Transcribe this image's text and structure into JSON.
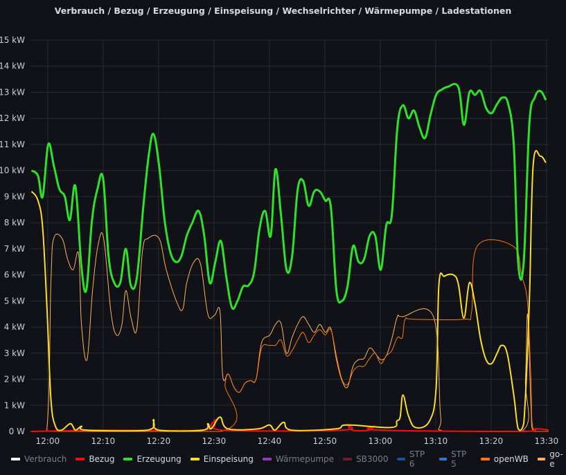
{
  "chart_data": {
    "type": "line",
    "title": "Verbrauch / Bezug / Erzeugung / Einspeisung / Wechselrichter / Wärmepumpe / Ladestationen",
    "x_unit": "minutes after 12:00",
    "xlim": [
      -3.1,
      90.4
    ],
    "ylim": [
      0,
      15
    ],
    "ylabel": "",
    "xlabel": "",
    "y_ticks": [
      0,
      1,
      2,
      3,
      4,
      5,
      6,
      7,
      8,
      9,
      10,
      11,
      12,
      13,
      14,
      15
    ],
    "y_tick_labels": [
      "0 W",
      "1 kW",
      "2 kW",
      "3 kW",
      "4 kW",
      "5 kW",
      "6 kW",
      "7 kW",
      "8 kW",
      "9 kW",
      "10 kW",
      "11 kW",
      "12 kW",
      "13 kW",
      "14 kW",
      "15 kW"
    ],
    "x_ticks": [
      0,
      10,
      20,
      30,
      40,
      50,
      60,
      70,
      80,
      90
    ],
    "x_tick_labels": [
      "12:00",
      "12:10",
      "12:20",
      "12:30",
      "12:40",
      "12:50",
      "13:00",
      "13:10",
      "13:20",
      "13:30"
    ],
    "grid": true,
    "legend_position": "bottom-left",
    "series": [
      {
        "name": "Verbrauch",
        "color": "#ffffff",
        "hidden": true,
        "points": []
      },
      {
        "name": "Bezug",
        "color": "#f2110f",
        "hidden": false,
        "points": [
          [
            -3,
            0
          ],
          [
            10,
            0.05
          ],
          [
            28,
            0.05
          ],
          [
            30.2,
            0.45
          ],
          [
            31.5,
            0.05
          ],
          [
            53,
            0.05
          ],
          [
            54,
            0.25
          ],
          [
            55,
            0.05
          ],
          [
            58,
            0.05
          ],
          [
            59,
            0.2
          ],
          [
            60,
            0.05
          ],
          [
            85,
            0
          ],
          [
            88,
            0.1
          ],
          [
            90.4,
            0.05
          ]
        ]
      },
      {
        "name": "Erzeugung",
        "color": "#2fe12a",
        "hidden": false,
        "points": [
          [
            -2.9,
            10
          ],
          [
            -1.75,
            9.8
          ],
          [
            -0.9,
            9.0
          ],
          [
            0.1,
            11.0
          ],
          [
            1.1,
            10.2
          ],
          [
            2.1,
            9.3
          ],
          [
            3.1,
            9.0
          ],
          [
            4,
            8.1
          ],
          [
            5,
            9.4
          ],
          [
            6.1,
            6.3
          ],
          [
            7,
            5.45
          ],
          [
            8,
            8.1
          ],
          [
            9,
            9.3
          ],
          [
            10,
            9.7
          ],
          [
            11,
            6.7
          ],
          [
            12,
            5.7
          ],
          [
            13.1,
            5.7
          ],
          [
            14.1,
            7.0
          ],
          [
            15,
            5.6
          ],
          [
            16.1,
            5.9
          ],
          [
            17.25,
            8.6
          ],
          [
            18.25,
            10.6
          ],
          [
            19.1,
            11.4
          ],
          [
            20.1,
            10.2
          ],
          [
            21.1,
            8.1
          ],
          [
            22.1,
            6.9
          ],
          [
            23.1,
            6.5
          ],
          [
            24.1,
            6.7
          ],
          [
            25.1,
            7.5
          ],
          [
            26.1,
            8.0
          ],
          [
            27.25,
            8.45
          ],
          [
            28.25,
            7.5
          ],
          [
            29.25,
            5.7
          ],
          [
            30.25,
            6.5
          ],
          [
            31.25,
            7.3
          ],
          [
            32.25,
            5.9
          ],
          [
            33.25,
            4.75
          ],
          [
            34.25,
            5.0
          ],
          [
            35.25,
            5.55
          ],
          [
            36.25,
            5.6
          ],
          [
            37.25,
            6.1
          ],
          [
            38.25,
            7.8
          ],
          [
            39.25,
            8.45
          ],
          [
            40.25,
            7.5
          ],
          [
            41.1,
            10.05
          ],
          [
            42.1,
            8.3
          ],
          [
            43.1,
            6.2
          ],
          [
            44.1,
            6.7
          ],
          [
            45.1,
            9.25
          ],
          [
            46.1,
            9.6
          ],
          [
            47.1,
            8.65
          ],
          [
            48.1,
            9.2
          ],
          [
            49.1,
            9.2
          ],
          [
            50.1,
            8.85
          ],
          [
            51.1,
            8.6
          ],
          [
            52.1,
            5.4
          ],
          [
            53.1,
            5.0
          ],
          [
            54.1,
            5.55
          ],
          [
            55.1,
            7.1
          ],
          [
            56.1,
            6.5
          ],
          [
            57.1,
            6.6
          ],
          [
            58.1,
            7.5
          ],
          [
            59.1,
            7.5
          ],
          [
            60.1,
            6.2
          ],
          [
            61.1,
            7.9
          ],
          [
            62.1,
            8.3
          ],
          [
            63.1,
            11.65
          ],
          [
            64.1,
            12.5
          ],
          [
            65.1,
            12.0
          ],
          [
            66.1,
            12.3
          ],
          [
            67.1,
            11.65
          ],
          [
            68.1,
            11.25
          ],
          [
            69.1,
            12.15
          ],
          [
            70.1,
            12.9
          ],
          [
            71.1,
            13.1
          ],
          [
            72.1,
            13.2
          ],
          [
            74.1,
            13.2
          ],
          [
            75.1,
            11.75
          ],
          [
            76.1,
            13.0
          ],
          [
            77.1,
            12.9
          ],
          [
            78.1,
            13.05
          ],
          [
            79.1,
            12.4
          ],
          [
            80.1,
            12.2
          ],
          [
            81.1,
            12.55
          ],
          [
            82.1,
            12.8
          ],
          [
            83.1,
            12.55
          ],
          [
            84.1,
            11.0
          ],
          [
            84.9,
            6.45
          ],
          [
            85.9,
            6.5
          ],
          [
            86.9,
            11.75
          ],
          [
            87.9,
            12.8
          ],
          [
            88.9,
            13.05
          ],
          [
            89.9,
            12.7
          ]
        ]
      },
      {
        "name": "Einspeisung",
        "color": "#fade2a",
        "hidden": false,
        "points": [
          [
            -2.9,
            9.2
          ],
          [
            -1.75,
            8.85
          ],
          [
            -0.9,
            7.8
          ],
          [
            -0.1,
            4.6
          ],
          [
            0.6,
            1.2
          ],
          [
            1.4,
            0.2
          ],
          [
            2.5,
            0.05
          ],
          [
            4.1,
            0.3
          ],
          [
            5,
            0.05
          ],
          [
            6.1,
            0.2
          ],
          [
            7,
            0.05
          ],
          [
            18,
            0.05
          ],
          [
            19.1,
            0.45
          ],
          [
            20,
            0.05
          ],
          [
            28,
            0.05
          ],
          [
            28.9,
            0.3
          ],
          [
            29.5,
            0.1
          ],
          [
            31.1,
            0.55
          ],
          [
            32.5,
            0.1
          ],
          [
            38,
            0.1
          ],
          [
            40,
            0.25
          ],
          [
            41,
            0.05
          ],
          [
            42.6,
            0.35
          ],
          [
            44,
            0.05
          ],
          [
            52,
            0.1
          ],
          [
            54,
            0.25
          ],
          [
            62,
            0.15
          ],
          [
            63,
            0.4
          ],
          [
            63.6,
            0.55
          ],
          [
            64.1,
            1.4
          ],
          [
            65.1,
            0.6
          ],
          [
            66.4,
            0.15
          ],
          [
            68.9,
            0.4
          ],
          [
            70.1,
            1.7
          ],
          [
            70.6,
            5.65
          ],
          [
            71.6,
            5.95
          ],
          [
            73.2,
            6.0
          ],
          [
            74.1,
            5.65
          ],
          [
            75.1,
            4.35
          ],
          [
            76.1,
            5.7
          ],
          [
            77.1,
            4.9
          ],
          [
            78.1,
            3.55
          ],
          [
            79.1,
            2.75
          ],
          [
            80.1,
            2.6
          ],
          [
            81.1,
            3.0
          ],
          [
            81.9,
            3.3
          ],
          [
            82.9,
            3.0
          ],
          [
            84.1,
            1.4
          ],
          [
            84.9,
            0.1
          ],
          [
            85.9,
            0.3
          ],
          [
            86.9,
            4.9
          ],
          [
            87.6,
            10.2
          ],
          [
            88.9,
            10.55
          ],
          [
            89.9,
            10.3
          ]
        ]
      },
      {
        "name": "Wärmepumpe",
        "color": "#8f3bb8",
        "hidden": true,
        "points": []
      },
      {
        "name": "SB3000",
        "color": "#6e1f2b",
        "hidden": true,
        "points": []
      },
      {
        "name": "STP 6",
        "color": "#1f4ba0",
        "hidden": true,
        "points": []
      },
      {
        "name": "STP 5",
        "color": "#3274d9",
        "hidden": true,
        "points": []
      },
      {
        "name": "openWB",
        "color": "#ff780a",
        "hidden": false,
        "points": [
          [
            -3,
            0
          ],
          [
            31.2,
            0
          ],
          [
            32,
            1.8
          ],
          [
            32.6,
            2.2
          ],
          [
            33.6,
            1.7
          ],
          [
            34.6,
            1.5
          ],
          [
            35.6,
            1.85
          ],
          [
            36.6,
            1.95
          ],
          [
            37.6,
            2.0
          ],
          [
            38.6,
            3.2
          ],
          [
            40,
            3.3
          ],
          [
            41.1,
            3.3
          ],
          [
            42.1,
            3.5
          ],
          [
            43.1,
            2.9
          ],
          [
            44.1,
            3.1
          ],
          [
            45.1,
            3.5
          ],
          [
            46.1,
            3.8
          ],
          [
            47.1,
            3.4
          ],
          [
            48.1,
            3.7
          ],
          [
            49.1,
            3.9
          ],
          [
            50.1,
            3.7
          ],
          [
            51.1,
            3.9
          ],
          [
            52.1,
            2.9
          ],
          [
            53.1,
            2.0
          ],
          [
            54.1,
            1.8
          ],
          [
            55.1,
            2.3
          ],
          [
            56.1,
            2.5
          ],
          [
            57.1,
            2.5
          ],
          [
            58.1,
            2.8
          ],
          [
            59.1,
            3.0
          ],
          [
            60.1,
            2.6
          ],
          [
            61.1,
            2.9
          ],
          [
            62.1,
            3.1
          ],
          [
            63.1,
            3.6
          ],
          [
            64,
            3.6
          ],
          [
            64.5,
            4.3
          ],
          [
            66,
            4.3
          ],
          [
            75,
            4.3
          ],
          [
            76.5,
            4.6
          ],
          [
            77.5,
            7.1
          ],
          [
            84,
            7.1
          ],
          [
            85.5,
            6.0
          ],
          [
            86.6,
            4.9
          ],
          [
            87.2,
            2.0
          ],
          [
            87.7,
            0
          ],
          [
            90.4,
            0
          ]
        ]
      },
      {
        "name": "go-e",
        "color": "#ffb357",
        "hidden": false,
        "points": [
          [
            -3,
            0
          ],
          [
            -0.2,
            0
          ],
          [
            0.6,
            5.8
          ],
          [
            1.1,
            7.4
          ],
          [
            2.6,
            7.4
          ],
          [
            3.6,
            6.6
          ],
          [
            4.6,
            6.2
          ],
          [
            5.6,
            6.8
          ],
          [
            6.1,
            4.1
          ],
          [
            7.1,
            2.75
          ],
          [
            8.1,
            5.4
          ],
          [
            9.1,
            7.15
          ],
          [
            10.1,
            7.4
          ],
          [
            11.4,
            4.6
          ],
          [
            12.4,
            3.7
          ],
          [
            13.4,
            4.1
          ],
          [
            14.1,
            5.4
          ],
          [
            15.1,
            4.3
          ],
          [
            16.1,
            3.95
          ],
          [
            17.1,
            6.9
          ],
          [
            18.1,
            7.4
          ],
          [
            20.1,
            7.4
          ],
          [
            21.4,
            6.2
          ],
          [
            23.4,
            4.9
          ],
          [
            24.4,
            4.7
          ],
          [
            25.1,
            5.7
          ],
          [
            26.4,
            6.5
          ],
          [
            27.6,
            6.4
          ],
          [
            28.9,
            4.5
          ],
          [
            30.1,
            4.45
          ],
          [
            31.1,
            4.6
          ],
          [
            31.6,
            2.1
          ],
          [
            32.6,
            2.2
          ],
          [
            33.6,
            1.7
          ],
          [
            34.6,
            1.5
          ],
          [
            35.6,
            1.85
          ],
          [
            36.6,
            1.95
          ],
          [
            37.6,
            2.0
          ],
          [
            38.6,
            3.4
          ],
          [
            40.1,
            3.7
          ],
          [
            41.1,
            4.1
          ],
          [
            42.1,
            4.15
          ],
          [
            43.1,
            3.0
          ],
          [
            44.1,
            3.6
          ],
          [
            45.1,
            4.1
          ],
          [
            46.1,
            4.4
          ],
          [
            47.1,
            4.1
          ],
          [
            48.1,
            3.8
          ],
          [
            49.1,
            4.1
          ],
          [
            50.1,
            3.8
          ],
          [
            51.1,
            3.95
          ],
          [
            52.1,
            2.75
          ],
          [
            53.1,
            1.95
          ],
          [
            54.1,
            1.7
          ],
          [
            55.1,
            2.5
          ],
          [
            56.1,
            2.75
          ],
          [
            57.1,
            2.8
          ],
          [
            58.1,
            3.2
          ],
          [
            59.1,
            3.0
          ],
          [
            60.1,
            2.75
          ],
          [
            61.1,
            2.9
          ],
          [
            62.1,
            3.55
          ],
          [
            63.1,
            4.4
          ],
          [
            64,
            4.4
          ],
          [
            69.6,
            4.4
          ],
          [
            70.9,
            0.6
          ],
          [
            71.9,
            0.0
          ],
          [
            85.5,
            0
          ],
          [
            86.2,
            2.0
          ],
          [
            86.6,
            4.5
          ],
          [
            87.2,
            1.0
          ],
          [
            87.7,
            0
          ],
          [
            90.4,
            0
          ]
        ]
      }
    ]
  }
}
